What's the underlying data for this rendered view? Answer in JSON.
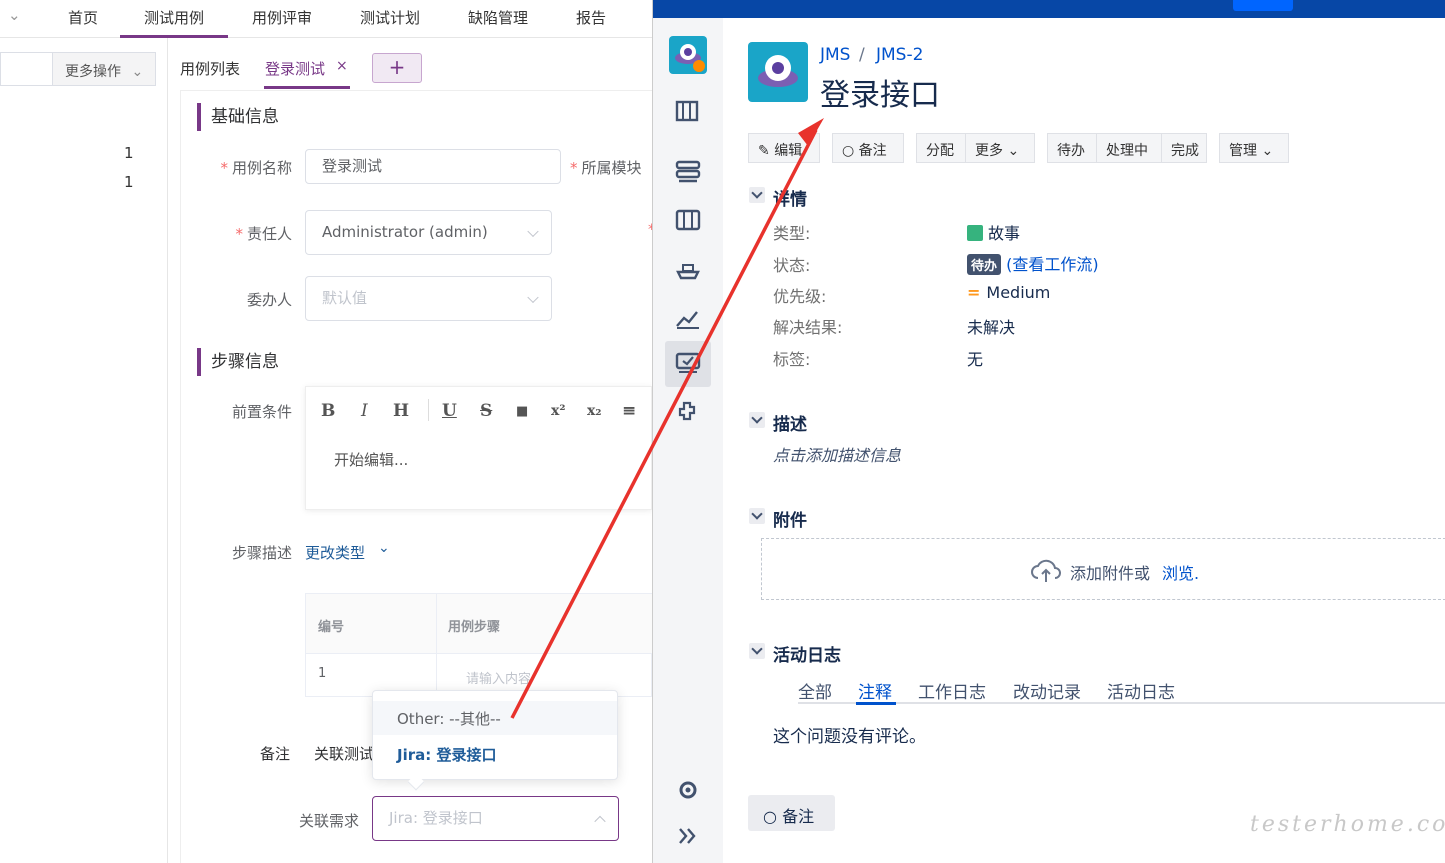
{
  "left": {
    "nav": [
      "首页",
      "测试用例",
      "用例评审",
      "测试计划",
      "缺陷管理",
      "报告"
    ],
    "more_ops": "更多操作",
    "counts": [
      "1",
      "1"
    ],
    "tabs": {
      "list": "用例列表",
      "current": "登录测试",
      "close": "×",
      "add": "+"
    },
    "basic_section": "基础信息",
    "case_name_label": "用例名称",
    "case_name_value": "登录测试",
    "module_label": "所属模块",
    "owner_label": "责任人",
    "owner_value": "Administrator (admin)",
    "delegate_label": "委办人",
    "delegate_placeholder": "默认值",
    "steps_section": "步骤信息",
    "precondition_label": "前置条件",
    "toolbar": [
      "B",
      "I",
      "H",
      "U",
      "S",
      "■",
      "x²",
      "x₂",
      "≡"
    ],
    "editor_placeholder": "开始编辑...",
    "step_desc_label": "步骤描述",
    "change_type": "更改类型",
    "table_headers": [
      "编号",
      "用例步骤"
    ],
    "row_no": "1",
    "row_placeholder": "请输入内容",
    "bottom_tabs": [
      "备注",
      "关联测试"
    ],
    "dropdown_options": [
      "Other: --其他--",
      "Jira: 登录接口"
    ],
    "req_label": "关联需求",
    "req_value": "Jira: 登录接口"
  },
  "right": {
    "crumb_project": "JMS",
    "crumb_sep": "/",
    "crumb_issue": "JMS-2",
    "title": "登录接口",
    "buttons": [
      "编辑",
      "备注",
      "分配",
      "更多",
      "待办",
      "处理中",
      "完成",
      "管理"
    ],
    "details_section": "详情",
    "details": [
      {
        "key": "类型:",
        "value": "故事"
      },
      {
        "key": "状态:",
        "value": "待办",
        "link": "(查看工作流)"
      },
      {
        "key": "优先级:",
        "value": "Medium"
      },
      {
        "key": "解决结果:",
        "value": "未解决"
      },
      {
        "key": "标签:",
        "value": "无"
      }
    ],
    "desc_section": "描述",
    "desc_placeholder": "点击添加描述信息",
    "attach_section": "附件",
    "attach_text": "添加附件或",
    "attach_link": "浏览.",
    "activity_section": "活动日志",
    "activity_tabs": [
      "全部",
      "注释",
      "工作日志",
      "改动记录",
      "活动日志"
    ],
    "no_comments": "这个问题没有评论。",
    "comment_button": "备注"
  },
  "watermark": "testerhome.com",
  "colors": {
    "brand_purple": "#783887",
    "jira_blue": "#0052cc",
    "jira_nav": "#0747a6",
    "arrow_red": "#e8322c"
  }
}
